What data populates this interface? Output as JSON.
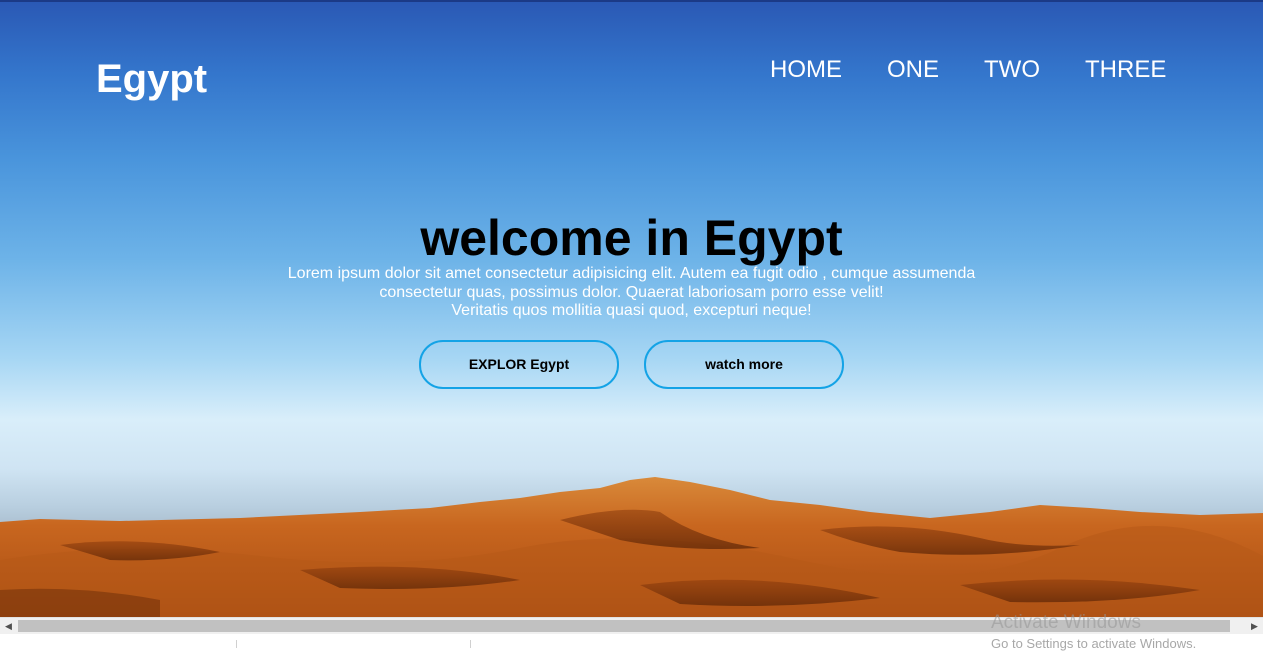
{
  "header": {
    "brand": "Egypt",
    "nav": [
      {
        "label": "HOME"
      },
      {
        "label": "ONE"
      },
      {
        "label": "TWO"
      },
      {
        "label": "THREE"
      }
    ]
  },
  "hero": {
    "title": "welcome in Egypt",
    "lines": [
      "Lorem ipsum dolor sit amet consectetur adipisicing elit. Autem ea fugit odio , cumque assumenda",
      "consectetur quas, possimus dolor. Quaerat laboriosam porro esse velit!",
      "Veritatis quos mollitia quasi quod, excepturi neque!"
    ],
    "buttons": {
      "explore": "EXPLOR Egypt",
      "watch": "watch more"
    },
    "background": "desert-dunes-photo"
  },
  "colors": {
    "button_border": "#14a3e6",
    "sky_top": "#2a58b4",
    "sand": "#c8641e"
  },
  "os": {
    "watermark_title": "Activate Windows",
    "watermark_sub": "Go to Settings to activate Windows."
  },
  "icons": {
    "scroll_left": "triangle-left-icon",
    "scroll_right": "triangle-right-icon"
  }
}
